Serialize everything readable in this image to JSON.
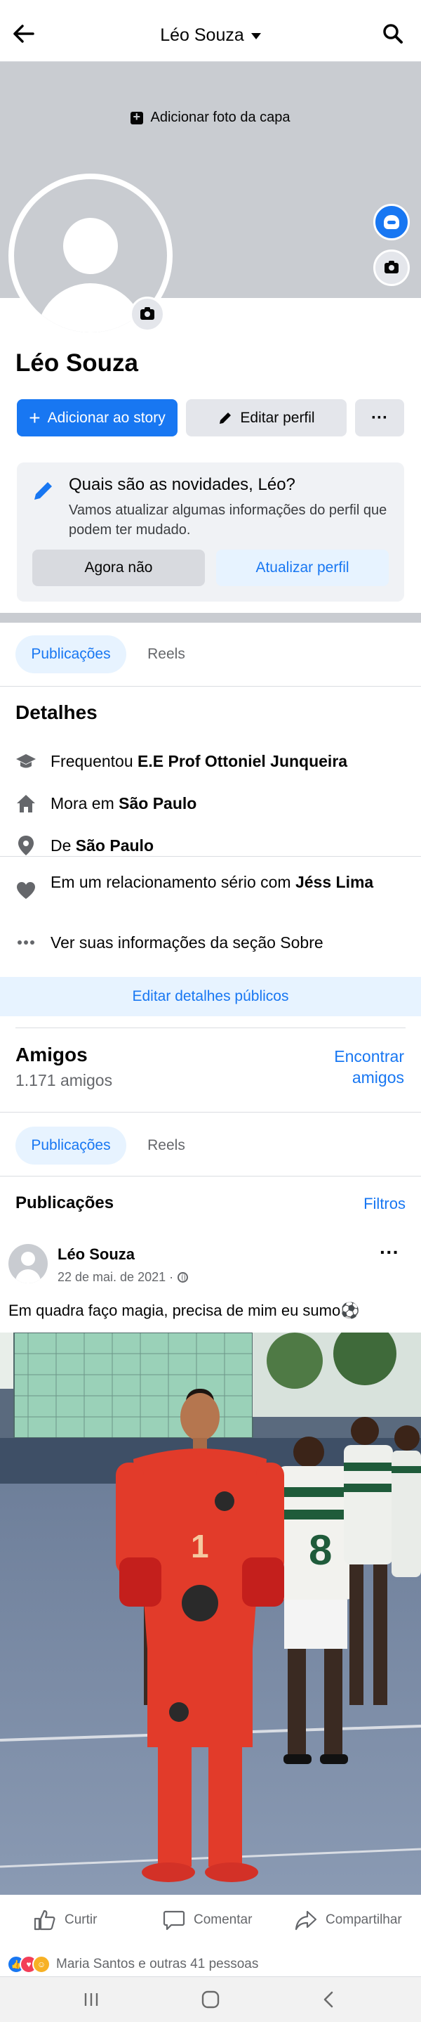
{
  "topbar": {
    "title": "Léo Souza"
  },
  "cover": {
    "add_cover_label": "Adicionar foto da capa"
  },
  "profile": {
    "name": "Léo Souza",
    "add_story_label": "Adicionar ao story",
    "edit_profile_label": "Editar perfil",
    "more_label": "···"
  },
  "news_card": {
    "question": "Quais são as novidades, Léo?",
    "subtitle": "Vamos atualizar algumas informações do perfil que podem ter mudado.",
    "not_now_label": "Agora não",
    "update_label": "Atualizar perfil"
  },
  "tabs": {
    "posts_label": "Publicações",
    "reels_label": "Reels"
  },
  "details": {
    "title": "Detalhes",
    "rows": [
      {
        "prefix": "Frequentou ",
        "bold": "E.E Prof Ottoniel Junqueira",
        "icon": "graduation-cap-icon"
      },
      {
        "prefix": "Mora em ",
        "bold": "São Paulo",
        "icon": "home-icon"
      },
      {
        "prefix": "De ",
        "bold": "São Paulo",
        "icon": "location-pin-icon"
      },
      {
        "prefix": "Em um relacionamento sério com ",
        "bold": "Jéss Lima",
        "icon": "heart-icon"
      },
      {
        "prefix": "Ver suas informações da seção Sobre",
        "bold": "",
        "icon": "more-dots-icon"
      }
    ],
    "edit_public_label": "Editar detalhes públicos"
  },
  "friends": {
    "title": "Amigos",
    "count": "1.171 amigos",
    "find_label": "Encontrar amigos"
  },
  "publications": {
    "title": "Publicações",
    "filters_label": "Filtros"
  },
  "post": {
    "author": "Léo Souza",
    "date": "22 de mai. de 2021 ·",
    "text": "Em quadra faço magia, precisa de mim eu sumo⚽",
    "like_label": "Curtir",
    "comment_label": "Comentar",
    "share_label": "Compartilhar",
    "reactions_text": "Maria Santos e outras 41 pessoas"
  },
  "colors": {
    "accent": "#1877f2",
    "accent_light": "#e7f3ff",
    "grey_button": "#e4e6eb",
    "cover": "#c9ccd1"
  }
}
